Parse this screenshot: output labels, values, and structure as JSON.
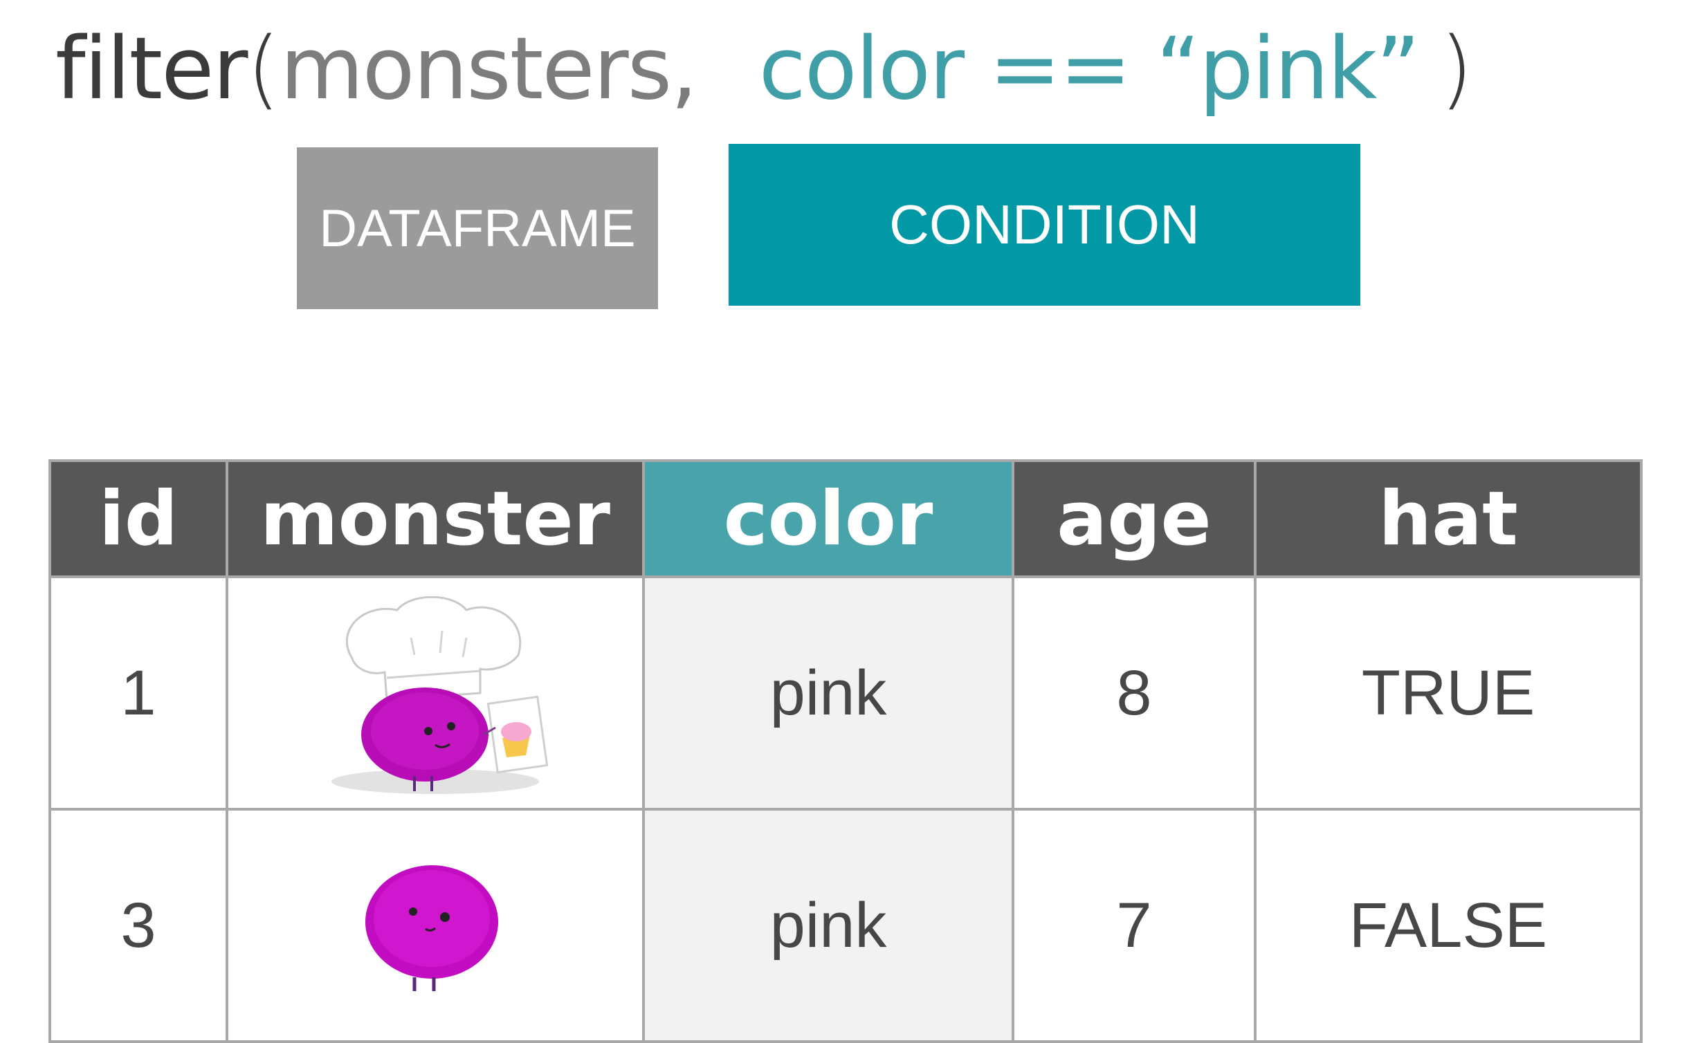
{
  "code": {
    "function": "filter",
    "open_paren": "(",
    "dataframe_arg": "monsters,",
    "condition_arg": "color == “pink”",
    "close_paren": ")"
  },
  "labels": {
    "dataframe": "DATAFRAME",
    "condition": "CONDITION"
  },
  "table": {
    "headers": [
      "id",
      "monster",
      "color",
      "age",
      "hat"
    ],
    "highlight_column": "color",
    "rows": [
      {
        "id": "1",
        "monster_icon": "chef-pink-monster-icon",
        "color": "pink",
        "age": "8",
        "hat": "TRUE"
      },
      {
        "id": "3",
        "monster_icon": "pink-monster-icon",
        "color": "pink",
        "age": "7",
        "hat": "FALSE"
      }
    ]
  },
  "colors": {
    "function_text": "#3b3b3b",
    "dataframe_text": "#7d7d7d",
    "condition_text": "#3f9ea6",
    "dataframe_label_bg": "#9b9b9b",
    "condition_label_bg": "#0398a5",
    "header_bg": "#575757",
    "highlight_header_bg": "#48a3ab",
    "highlight_cell_bg": "#f2f2f2",
    "monster": "#c00cc0"
  }
}
